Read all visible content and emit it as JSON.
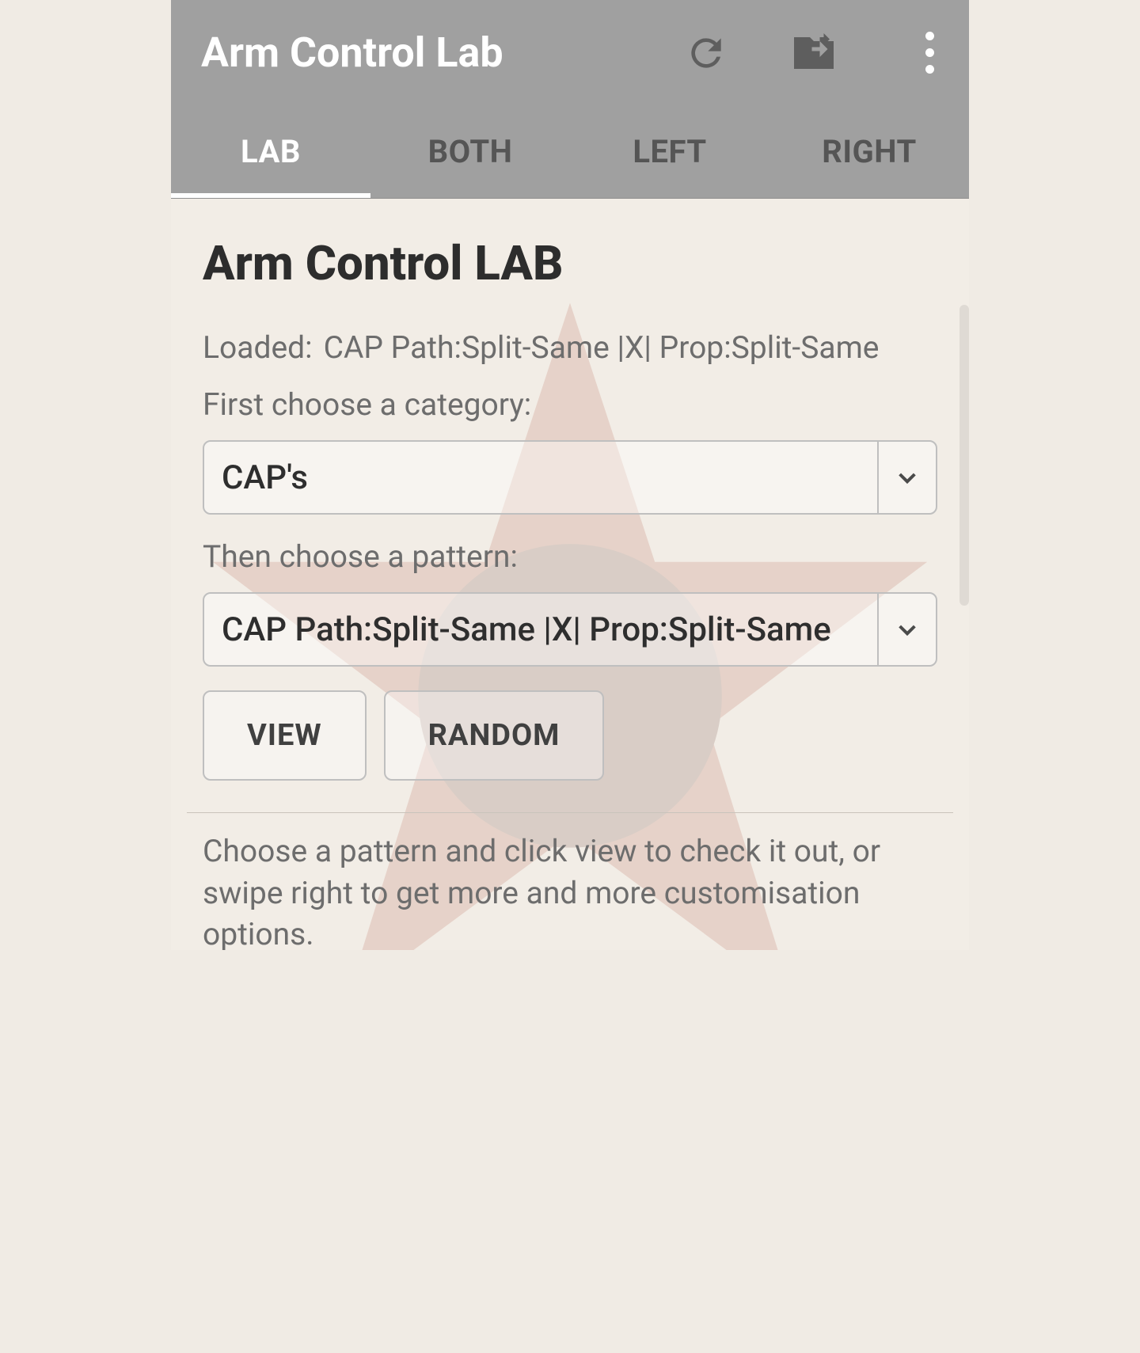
{
  "appbar": {
    "title": "Arm Control Lab"
  },
  "tabs": [
    {
      "label": "LAB",
      "active": true
    },
    {
      "label": "BOTH",
      "active": false
    },
    {
      "label": "LEFT",
      "active": false
    },
    {
      "label": "RIGHT",
      "active": false
    }
  ],
  "main": {
    "heading": "Arm Control LAB",
    "loaded_label": "Loaded:",
    "loaded_value": "CAP Path:Split-Same |X| Prop:Split-Same",
    "category_label": "First choose a category:",
    "category_value": "CAP's",
    "pattern_label": "Then choose a pattern:",
    "pattern_value": "CAP Path:Split-Same |X| Prop:Split-Same",
    "buttons": {
      "view": "VIEW",
      "random": "RANDOM"
    },
    "hint": "Choose a pattern and click view to check it out, or swipe right to get more and more customisation options."
  }
}
